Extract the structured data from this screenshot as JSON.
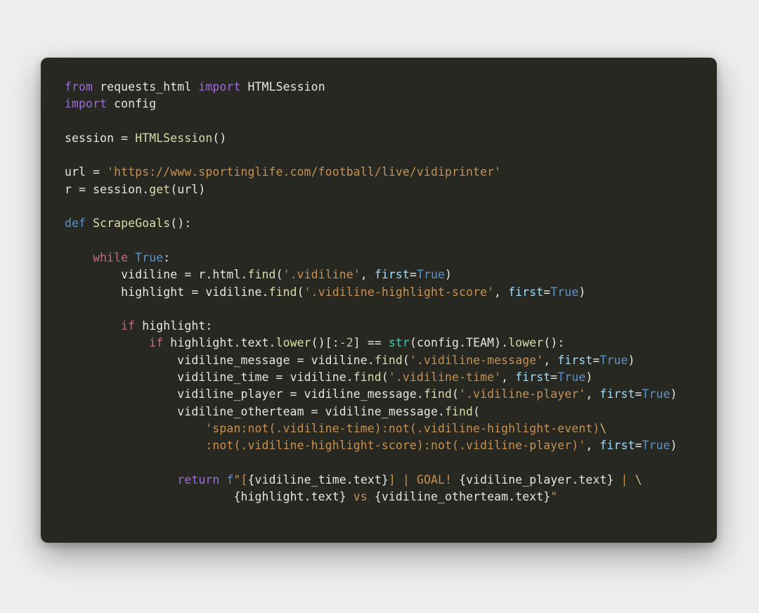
{
  "code": {
    "l1": {
      "from": "from",
      "mod1": "requests_html",
      "import": "import",
      "mod2": "HTMLSession"
    },
    "l2": {
      "import": "import",
      "mod": "config"
    },
    "l4": {
      "lhs": "session",
      "eq": " = ",
      "fn": "HTMLSession",
      "call": "()"
    },
    "l6": {
      "lhs": "url",
      "eq": " = ",
      "str": "'https://www.sportinglife.com/football/live/vidiprinter'"
    },
    "l7": {
      "lhs": "r",
      "eq": " = ",
      "obj": "session.",
      "fn": "get",
      "open": "(",
      "arg": "url",
      "close": ")"
    },
    "l9": {
      "def": "def",
      "name": "ScrapeGoals",
      "sig": "():"
    },
    "l11": {
      "while": "while",
      "true": "True",
      "colon": ":"
    },
    "l12": {
      "lhs": "vidiline = r.html.",
      "fn": "find",
      "open": "(",
      "s": "'.vidiline'",
      "comma": ", ",
      "kw": "first",
      "eq2": "=",
      "true": "True",
      "close": ")"
    },
    "l13": {
      "lhs": "highlight = vidiline.",
      "fn": "find",
      "open": "(",
      "s": "'.vidiline-highlight-score'",
      "comma": ", ",
      "kw": "first",
      "eq2": "=",
      "true": "True",
      "close": ")"
    },
    "l15": {
      "if": "if",
      "cond": "highlight",
      "colon": ":"
    },
    "l16": {
      "if": "if",
      "a": "highlight.text.",
      "fnlower": "lower",
      "par1": "()[:",
      "neg2": "-2",
      "par2": "] == ",
      "strfn": "str",
      "par3": "(config.TEAM).",
      "fnlower2": "lower",
      "par4": "():"
    },
    "l17": {
      "lhs": "vidiline_message = vidiline.",
      "fn": "find",
      "open": "(",
      "s": "'.vidiline-message'",
      "comma": ", ",
      "kw": "first",
      "eq2": "=",
      "true": "True",
      "close": ")"
    },
    "l18": {
      "lhs": "vidiline_time = vidiline.",
      "fn": "find",
      "open": "(",
      "s": "'.vidiline-time'",
      "comma": ", ",
      "kw": "first",
      "eq2": "=",
      "true": "True",
      "close": ")"
    },
    "l19": {
      "lhs": "vidiline_player = vidiline_message.",
      "fn": "find",
      "open": "(",
      "s": "'.vidiline-player'",
      "comma": ", ",
      "kw": "first",
      "eq2": "=",
      "true": "True",
      "close": ")"
    },
    "l20": {
      "lhs": "vidiline_otherteam = vidiline_message.",
      "fn": "find",
      "open": "("
    },
    "l21": {
      "s": "'span:not(.vidiline-time):not(.vidiline-highlight-event)",
      "bs": "\\"
    },
    "l22": {
      "s": ":not(.vidiline-highlight-score):not(.vidiline-player)'",
      "comma": ", ",
      "kw": "first",
      "eq2": "=",
      "true": "True",
      "close": ")"
    },
    "l24": {
      "return": "return",
      "sp": " ",
      "f": "f",
      "q1": "\"[",
      "i1o": "{",
      "i1": "vidiline_time.text",
      "i1c": "}",
      "mid1": "] | GOAL! ",
      "i2o": "{",
      "i2": "vidiline_player.text",
      "i2c": "}",
      "mid2": " | ",
      "bs": "\\"
    },
    "l25a": {
      "i3o": "{",
      "i3": "highlight.text",
      "i3c": "}",
      "mid3": " vs ",
      "i4o": "{",
      "i4": "vidiline_otherteam.text",
      "i4c": "}",
      "q2": "\""
    },
    "indent": {
      "w": "    ",
      "ww": "        ",
      "www": "            ",
      "wwww": "                ",
      "wwwww": "                    ",
      "wwwwww": "                        "
    }
  }
}
